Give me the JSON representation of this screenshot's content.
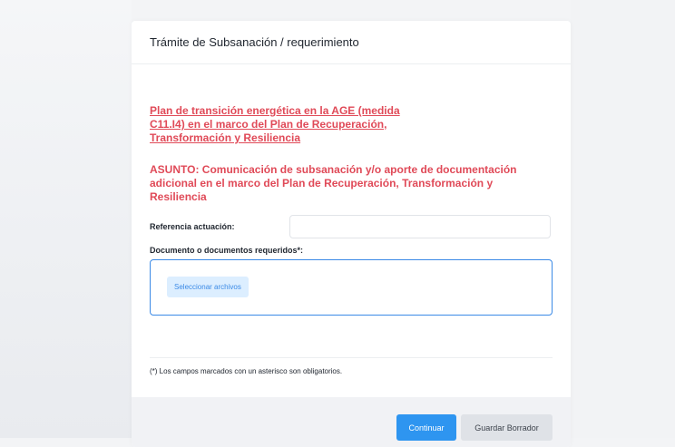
{
  "card": {
    "title": "Trámite de Subsanación / requerimiento"
  },
  "content": {
    "plan_link": "Plan de transición energética en la AGE (medida C11.I4) en el marco del Plan de Recuperación, Transformación y Resiliencia",
    "asunto": "ASUNTO: Comunicación de subsanación y/o aporte de documentación adicional en el marco del Plan de Recuperación, Transformación y Resiliencia"
  },
  "form": {
    "reference_label": "Referencia actuación:",
    "reference_value": "",
    "documents_label": "Documento o documentos requeridos*:",
    "select_files_label": "Seleccionar archivos",
    "footnote": "(*) Los campos marcados con un asterisco son obligatorios."
  },
  "footer": {
    "continue_label": "Continuar",
    "save_draft_label": "Guardar Borrador"
  },
  "colors": {
    "accent_red": "#e04a58",
    "primary_blue": "#2e95f0",
    "dropzone_border": "#3b8ae6"
  }
}
